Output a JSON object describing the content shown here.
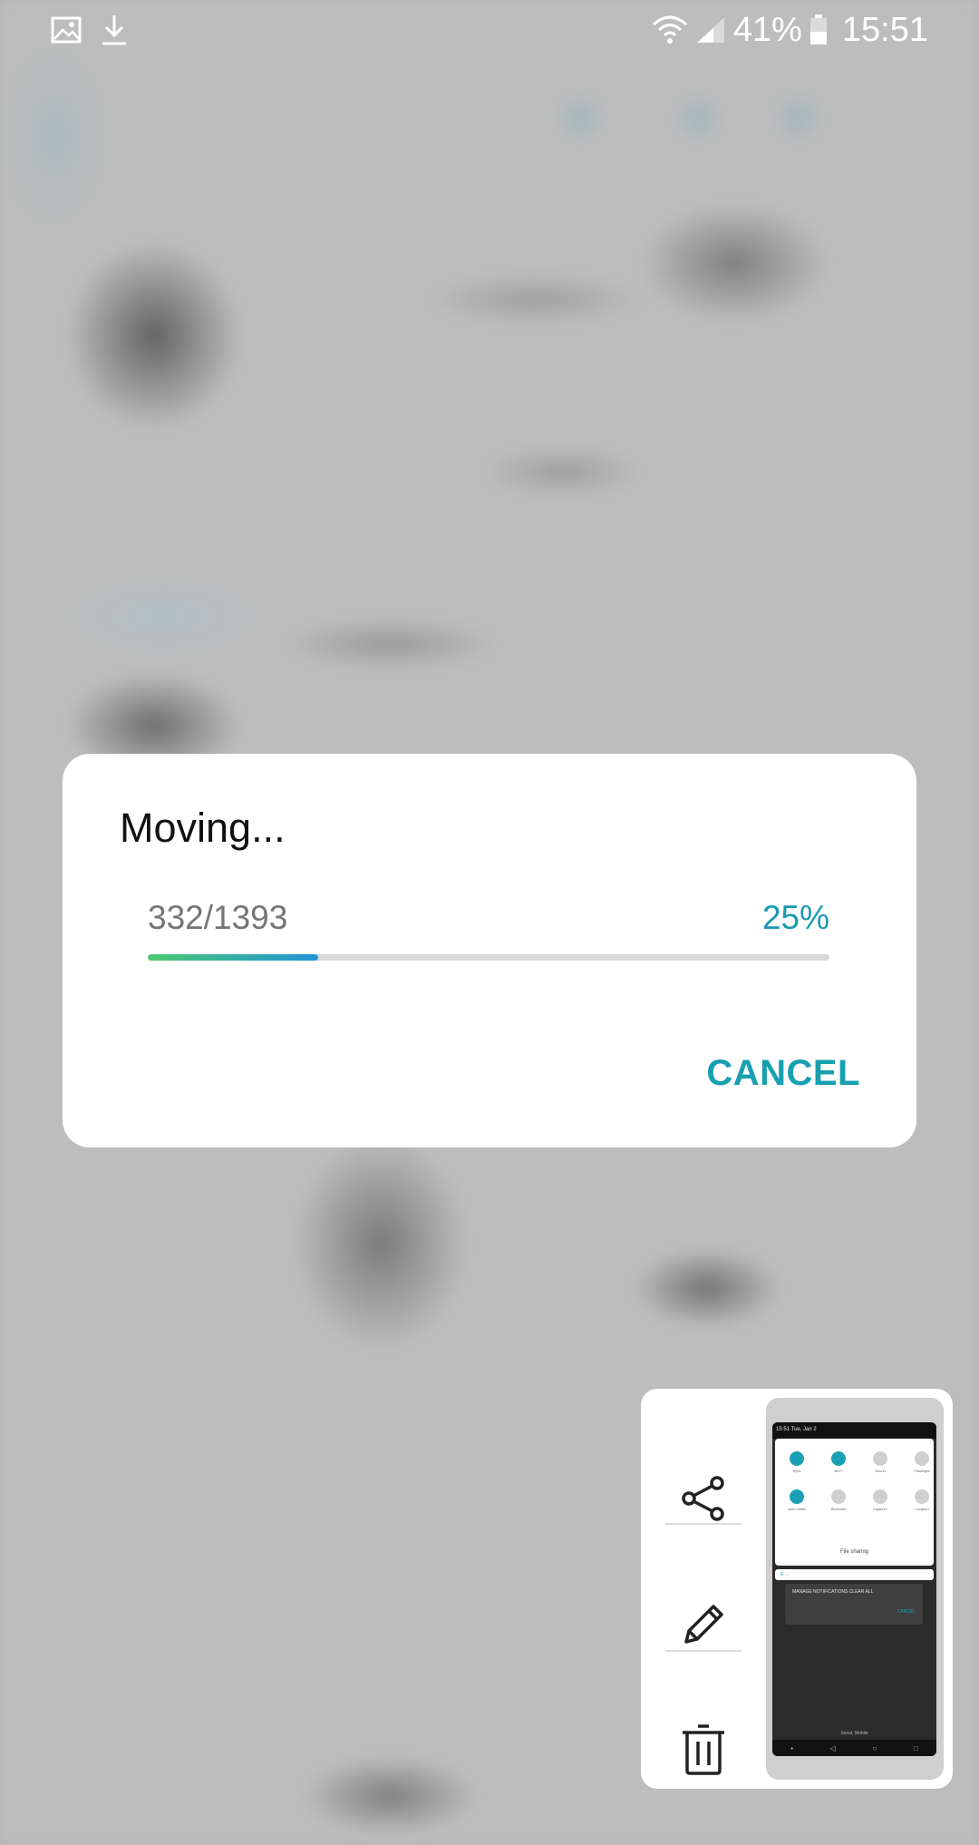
{
  "status_bar": {
    "battery_percent": "41%",
    "time": "15:51",
    "icons": [
      "gallery-icon",
      "download-icon",
      "wifi-icon",
      "cell-signal-icon",
      "battery-icon"
    ]
  },
  "dialog": {
    "title": "Moving...",
    "count_text": "332/1393",
    "percent_text": "25%",
    "progress": 0.25,
    "cancel_label": "CANCEL",
    "accent_color": "#17a0b0"
  },
  "screenshot_preview": {
    "actions": [
      "share-icon",
      "edit-icon",
      "delete-icon"
    ],
    "thumbnail": {
      "status_text": "15:51  Tue, Jan 2",
      "tiles_row1": [
        "Sync",
        "Wi-Fi",
        "Sound",
        "Flashlight"
      ],
      "tiles_row2": [
        "Auto rotate",
        "Bluetooth",
        "Capture+",
        "Location"
      ],
      "qs_footer": "File sharing",
      "notif_text": "E  ...",
      "dialog_line1": "MANAGE NOTIFICATIONS    CLEAR ALL",
      "dialog_cancel": "CANCEL",
      "bottom_text": "Seoul, Mobile",
      "nav": [
        "•",
        "◁",
        "○",
        "□"
      ]
    }
  }
}
